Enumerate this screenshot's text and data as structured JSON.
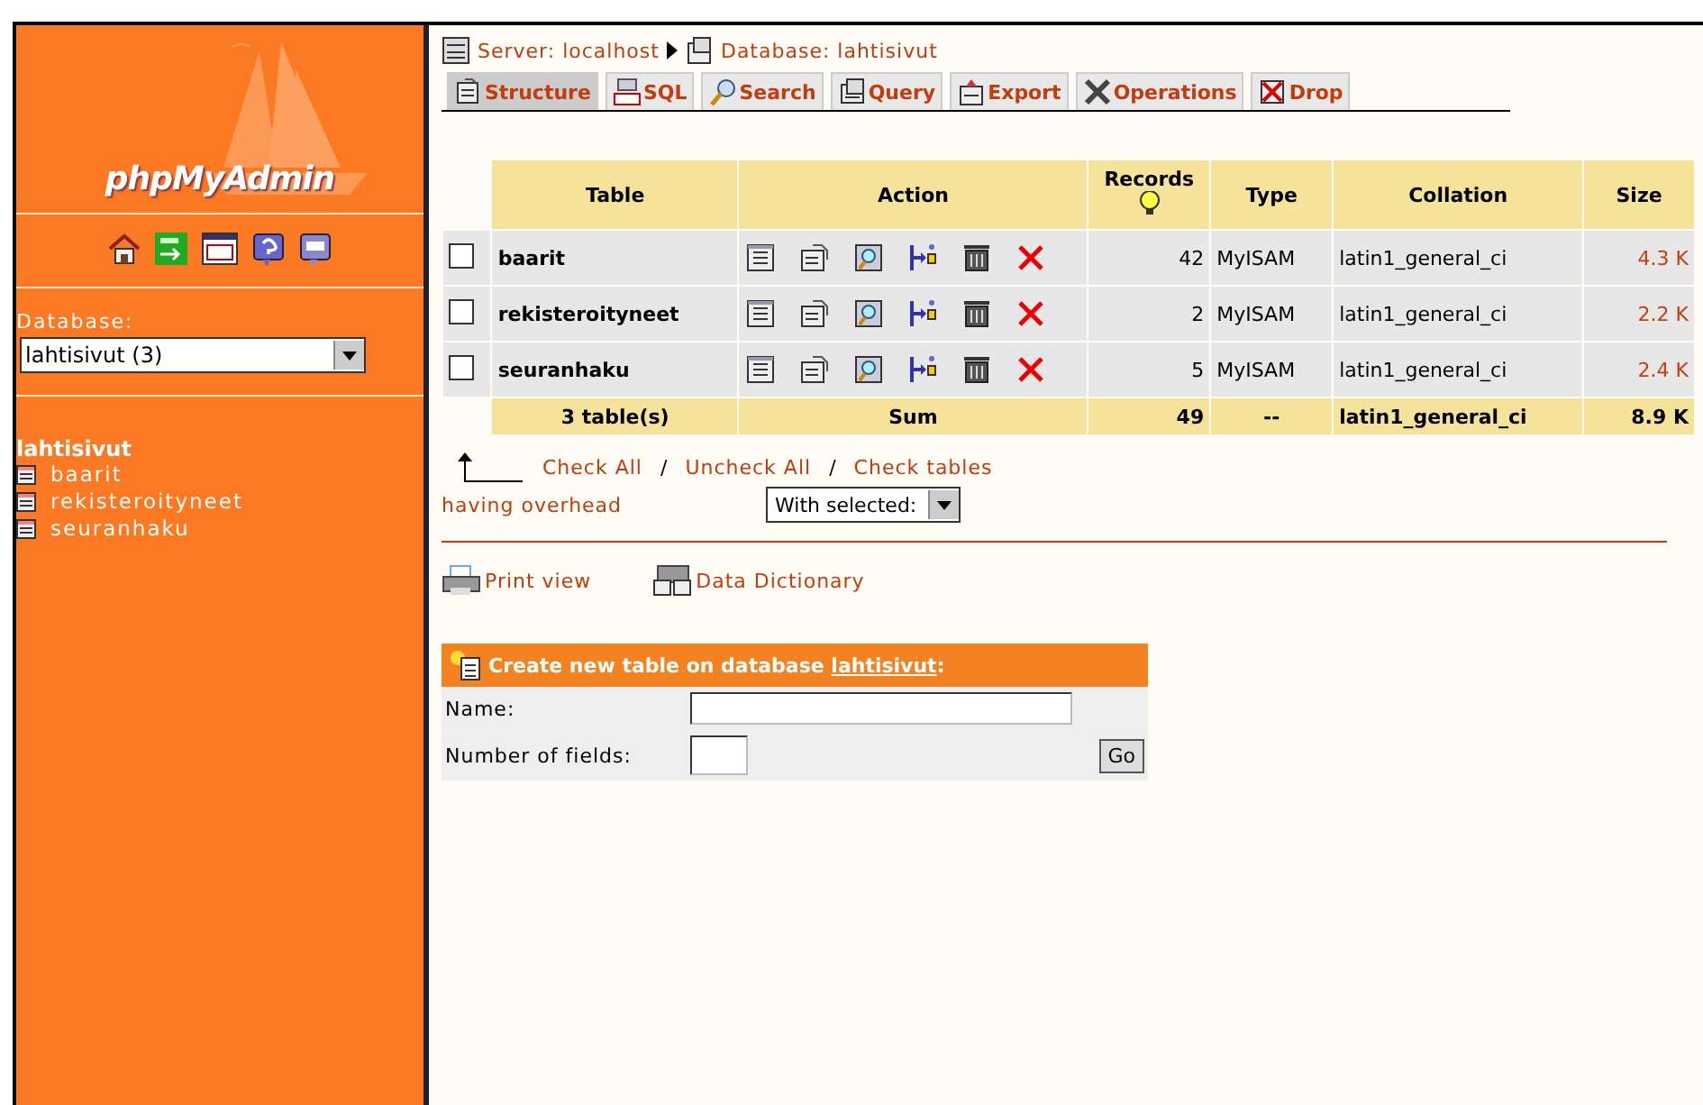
{
  "sidebar": {
    "logo": "phpMyAdmin",
    "database_label": "Database:",
    "database_select": "lahtisivut (3)",
    "tree": {
      "name": "lahtisivut",
      "children": [
        {
          "name": "baarit"
        },
        {
          "name": "rekisteroityneet"
        },
        {
          "name": "seuranhaku"
        }
      ]
    }
  },
  "breadcrumb": {
    "server": "Server: localhost",
    "database": "Database: lahtisivut"
  },
  "tabs": [
    {
      "label": "Structure",
      "kind": "structure",
      "selected": true
    },
    {
      "label": "SQL",
      "kind": "sql",
      "selected": false
    },
    {
      "label": "Search",
      "kind": "search",
      "selected": false
    },
    {
      "label": "Query",
      "kind": "query",
      "selected": false
    },
    {
      "label": "Export",
      "kind": "export",
      "selected": false
    },
    {
      "label": "Operations",
      "kind": "operations",
      "selected": false
    },
    {
      "label": "Drop",
      "kind": "drop",
      "selected": false
    }
  ],
  "table": {
    "columns": [
      "Table",
      "Action",
      "Records",
      "Type",
      "Collation",
      "Size"
    ],
    "rows": [
      {
        "checked": false,
        "name": "baarit",
        "records": "42",
        "type": "MyISAM",
        "collation": "latin1_general_ci",
        "size": "4.3 K"
      },
      {
        "checked": false,
        "name": "rekisteroityneet",
        "records": "2",
        "type": "MyISAM",
        "collation": "latin1_general_ci",
        "size": "2.2 K"
      },
      {
        "checked": false,
        "name": "seuranhaku",
        "records": "5",
        "type": "MyISAM",
        "collation": "latin1_general_ci",
        "size": "2.4 K"
      }
    ],
    "footer": {
      "tables": "3 table(s)",
      "sum": "Sum",
      "records": "49",
      "type": "--",
      "collation": "latin1_general_ci",
      "size": "8.9 K"
    }
  },
  "links": {
    "check_all": "Check All",
    "uncheck_all": "Uncheck All",
    "check_tables": "Check tables",
    "separator": "/",
    "having_overhead": "having overhead",
    "with_selected": "With selected:"
  },
  "print_view": "Print view",
  "data_dictionary": "Data Dictionary",
  "create_table": {
    "title": "Create new table on database ",
    "database": "lahtisivut",
    "colon": ":",
    "name_label": "Name:",
    "fields_label": "Number of fields:",
    "go": "Go"
  }
}
